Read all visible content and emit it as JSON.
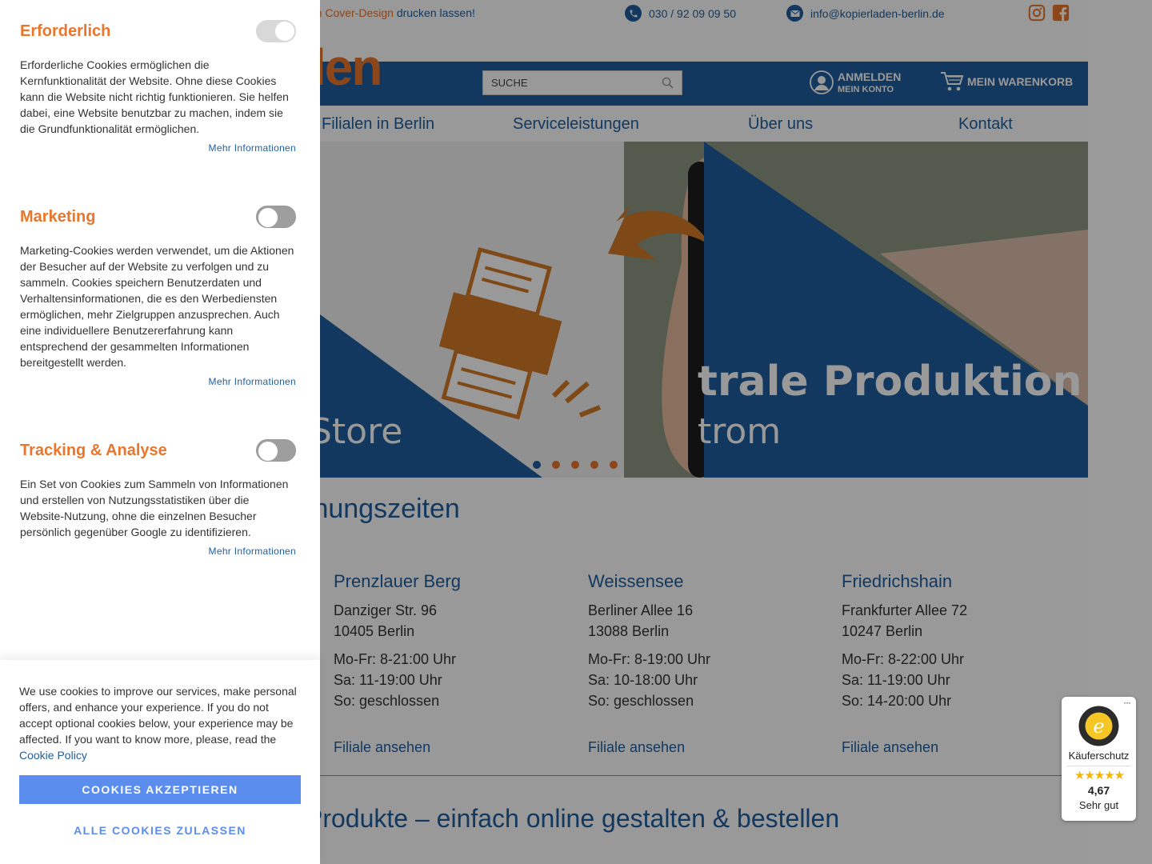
{
  "topbar": {
    "promo_prefix": "em Cover-Design",
    "promo_suffix": " drucken lassen!",
    "phone": "030 / 92 09 09 50",
    "email": "info@kopierladen-berlin.de"
  },
  "header": {
    "logo_text": "len",
    "search_placeholder": "SUCHE",
    "login_label": "ANMELDEN",
    "account_label": "MEIN KONTO",
    "cart_label": "MEIN WARENKORB"
  },
  "nav": {
    "items": [
      "Filialen in Berlin",
      "Serviceleistungen",
      "Über uns",
      "Kontakt"
    ]
  },
  "hero": {
    "text_left": "Store",
    "headline": "trale Produktion",
    "sub": "trom",
    "slide_count": 5,
    "active_slide": 1
  },
  "hours": {
    "title": "fnungszeiten",
    "branches": [
      {
        "name": "Prenzlauer Berg",
        "street": "Danziger Str. 96",
        "city": "10405 Berlin",
        "mofr": "Mo-Fr: 8-21:00 Uhr",
        "sa": "Sa: 11-19:00 Uhr",
        "so": "So: geschlossen",
        "link": "Filiale ansehen"
      },
      {
        "name": "Weissensee",
        "street": "Berliner Allee 16",
        "city": "13088 Berlin",
        "mofr": "Mo-Fr: 8-19:00 Uhr",
        "sa": "Sa: 10-18:00 Uhr",
        "so": "So: geschlossen",
        "link": "Filiale ansehen"
      },
      {
        "name": "Friedrichshain",
        "street": "Frankfurter Allee 72",
        "city": "10247 Berlin",
        "mofr": "Mo-Fr: 8-22:00 Uhr",
        "sa": "Sa: 11-19:00 Uhr",
        "so": "So: 14-20:00 Uhr",
        "link": "Filiale ansehen"
      }
    ]
  },
  "products": {
    "title": "Produkte – einfach online gestalten & bestellen"
  },
  "trusted_shops": {
    "label": "Käuferschutz",
    "stars": "★★★★★",
    "score": "4,67",
    "rating_text": "Sehr gut",
    "more": "···"
  },
  "cookies": {
    "categories": [
      {
        "title": "Erforderlich",
        "enabled": true,
        "text": "Erforderliche Cookies ermöglichen die Kernfunktionalität der Website. Ohne diese Cookies kann die Website nicht richtig funktionieren. Sie helfen dabei, eine Website benutzbar zu machen, indem sie die Grundfunktionalität ermöglichen.",
        "more": "Mehr Informationen"
      },
      {
        "title": "Marketing",
        "enabled": false,
        "text": "Marketing-Cookies werden verwendet, um die Aktionen der Besucher auf der Website zu verfolgen und zu sammeln. Cookies speichern Benutzerdaten und Verhaltensinformationen, die es den Werbediensten ermöglichen, mehr Zielgruppen anzusprechen. Auch eine individuellere Benutzererfahrung kann entsprechend der gesammelten Informationen bereitgestellt werden.",
        "more": "Mehr Informationen"
      },
      {
        "title": "Tracking & Analyse",
        "enabled": false,
        "text": "Ein Set von Cookies zum Sammeln von Informationen und erstellen von Nutzungsstatistiken über die Website-Nutzung, ohne die einzelnen Besucher persönlich gegenüber Google zu identifizieren.",
        "more": "Mehr Informationen"
      }
    ],
    "consent_text": "We use cookies to improve our services, make personal offers, and enhance your experience. If you do not accept optional cookies below, your experience may be affected. If you want to know more, please, read the",
    "policy_link": "Cookie Policy",
    "accept_button": "COOKIES AKZEPTIEREN",
    "allow_all_button": "ALLE COOKIES ZULASSEN"
  },
  "colors": {
    "brand_blue": "#1f5e9e",
    "brand_orange": "#e8762c",
    "button_blue": "#5b8def",
    "star_yellow": "#f7b500"
  }
}
